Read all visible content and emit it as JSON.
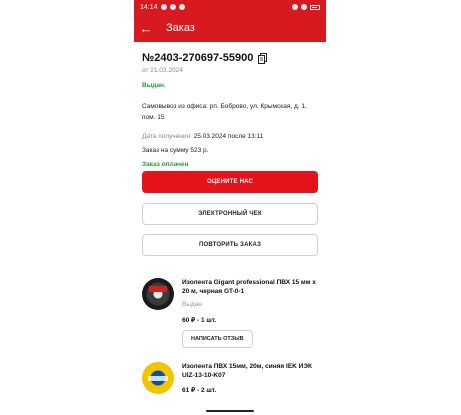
{
  "status_bar": {
    "time": "14:14"
  },
  "toolbar": {
    "title": "Заказ",
    "back_icon": "arrow-left-icon"
  },
  "order": {
    "number": "№2403-270697-55900",
    "date": "от 21.03.2024",
    "status": "Выдан.",
    "address": "Самовывоз из офиса: рп. Боброво, ул. Крымская, д. 1, пом. 15",
    "receive_label": "Дата получения:",
    "receive_value": "25.03.2024 после 13:11",
    "sum": "Заказ на сумму 523 р.",
    "paid": "Заказ оплачен"
  },
  "buttons": {
    "rate": "ОЦЕНИТЕ НАС",
    "receipt": "ЭЛЕКТРОННЫЙ ЧЕК",
    "repeat": "ПОВТОРИТЬ ЗАКАЗ"
  },
  "products": [
    {
      "name": "Изолента Gigant professional ПВХ 15 мм x 20 м, черная GT-0-1",
      "status": "Выдан",
      "price": "60 ₽ - 1 шт.",
      "review": "НАПИСАТЬ ОТЗЫВ"
    },
    {
      "name": "Изолента ПВХ 15мм, 20м, синяя IEK ИЭК UIZ-13-10-K07",
      "price": "61 ₽ - 2 шт."
    }
  ],
  "colors": {
    "brand_red": "#d71920",
    "paid_green": "#2e9b3a"
  }
}
